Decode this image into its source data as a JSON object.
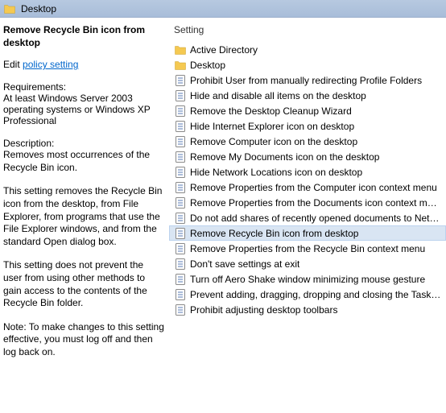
{
  "header": {
    "title": "Desktop"
  },
  "left": {
    "policy_title": "Remove Recycle Bin icon from desktop",
    "edit_prefix": "Edit ",
    "edit_link": "policy setting",
    "requirements_label": "Requirements:",
    "requirements_text": "At least Windows Server 2003 operating systems or Windows XP Professional",
    "description_label": "Description:",
    "description_paragraphs": [
      "Removes most occurrences of the Recycle Bin icon.",
      "This setting removes the Recycle Bin icon from the desktop, from File Explorer, from programs that use the File Explorer windows, and from the standard Open dialog box.",
      "This setting does not prevent the user from using other methods to gain access to the contents of the Recycle Bin folder.",
      "Note: To make changes to this setting effective, you must log off and then log back on."
    ]
  },
  "right": {
    "column_header": "Setting",
    "items": [
      {
        "type": "folder",
        "label": "Active Directory",
        "selected": false
      },
      {
        "type": "folder",
        "label": "Desktop",
        "selected": false
      },
      {
        "type": "policy",
        "label": "Prohibit User from manually redirecting Profile Folders",
        "selected": false
      },
      {
        "type": "policy",
        "label": "Hide and disable all items on the desktop",
        "selected": false
      },
      {
        "type": "policy",
        "label": "Remove the Desktop Cleanup Wizard",
        "selected": false
      },
      {
        "type": "policy",
        "label": "Hide Internet Explorer icon on desktop",
        "selected": false
      },
      {
        "type": "policy",
        "label": "Remove Computer icon on the desktop",
        "selected": false
      },
      {
        "type": "policy",
        "label": "Remove My Documents icon on the desktop",
        "selected": false
      },
      {
        "type": "policy",
        "label": "Hide Network Locations icon on desktop",
        "selected": false
      },
      {
        "type": "policy",
        "label": "Remove Properties from the Computer icon context menu",
        "selected": false
      },
      {
        "type": "policy",
        "label": "Remove Properties from the Documents icon context menu",
        "selected": false
      },
      {
        "type": "policy",
        "label": "Do not add shares of recently opened documents to Network Locations",
        "selected": false
      },
      {
        "type": "policy",
        "label": "Remove Recycle Bin icon from desktop",
        "selected": true
      },
      {
        "type": "policy",
        "label": "Remove Properties from the Recycle Bin context menu",
        "selected": false
      },
      {
        "type": "policy",
        "label": "Don't save settings at exit",
        "selected": false
      },
      {
        "type": "policy",
        "label": "Turn off Aero Shake window minimizing mouse gesture",
        "selected": false
      },
      {
        "type": "policy",
        "label": "Prevent adding, dragging, dropping and closing the Taskbar's toolbars",
        "selected": false
      },
      {
        "type": "policy",
        "label": "Prohibit adjusting desktop toolbars",
        "selected": false
      }
    ]
  }
}
